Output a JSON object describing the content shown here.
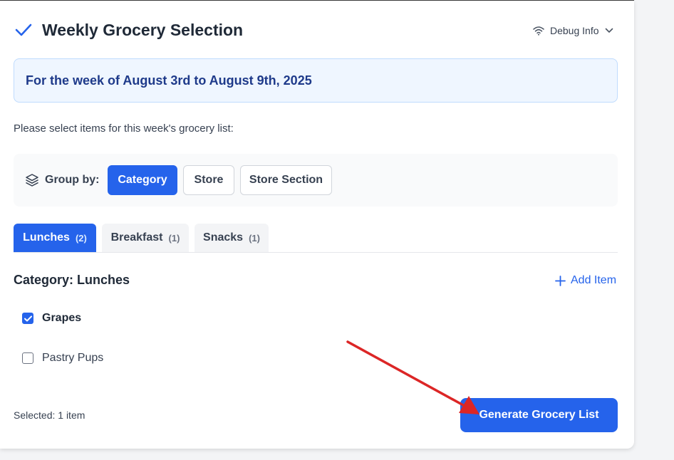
{
  "header": {
    "title": "Weekly Grocery Selection",
    "debug_label": "Debug Info"
  },
  "week_banner": "For the week of August 3rd to August 9th, 2025",
  "instructions": "Please select items for this week's grocery list:",
  "group_by": {
    "label": "Group by:",
    "options": [
      "Category",
      "Store",
      "Store Section"
    ],
    "selected": "Category"
  },
  "tabs": [
    {
      "label": "Lunches",
      "count": "(2)",
      "active": true
    },
    {
      "label": "Breakfast",
      "count": "(1)",
      "active": false
    },
    {
      "label": "Snacks",
      "count": "(1)",
      "active": false
    }
  ],
  "category": {
    "title": "Category: Lunches",
    "add_label": "Add Item",
    "items": [
      {
        "label": "Grapes",
        "checked": true
      },
      {
        "label": "Pastry Pups",
        "checked": false
      }
    ]
  },
  "footer": {
    "selected_text": "Selected: 1 item",
    "generate_label": "Generate Grocery List"
  },
  "colors": {
    "accent": "#2563eb",
    "banner_bg": "#eff6ff",
    "banner_text": "#1e3a8a",
    "annotation_arrow": "#dc2626"
  },
  "icons": {
    "header": "check-icon",
    "debug": "wifi-icon",
    "debug_toggle": "chevron-down-icon",
    "group_by": "layers-icon",
    "add": "plus-icon",
    "item_checked": "checkbox-checked-icon"
  }
}
